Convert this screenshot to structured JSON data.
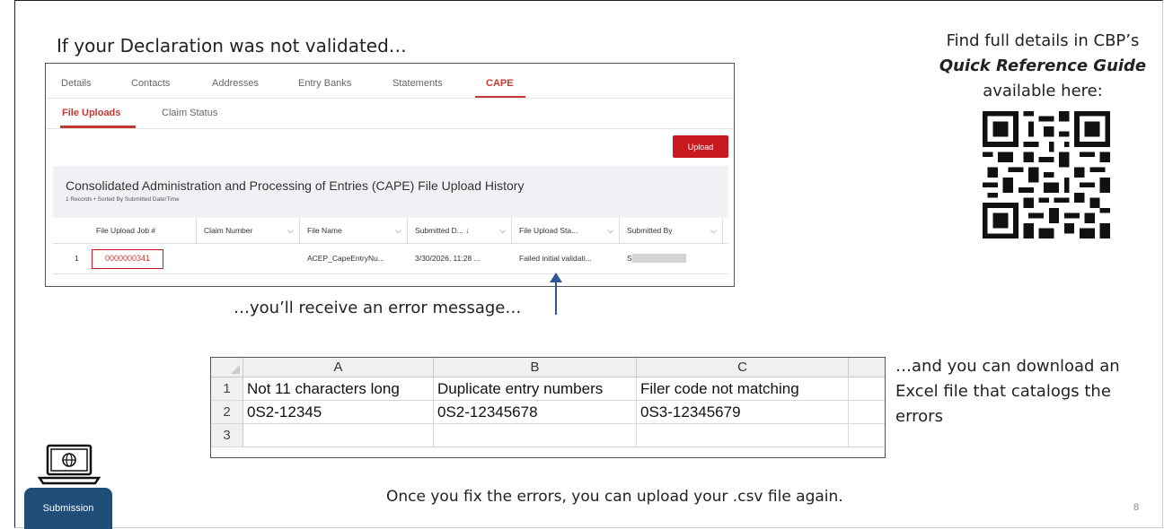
{
  "intro": "If your Declaration was not validated…",
  "guide": {
    "line1": "Find full details in CBP’s",
    "line2": "Quick Reference Guide",
    "line3": "available here:"
  },
  "app": {
    "tabs": [
      "Details",
      "Contacts",
      "Addresses",
      "Entry Banks",
      "Statements",
      "CAPE"
    ],
    "active_tab": "CAPE",
    "subtabs": [
      "File Uploads",
      "Claim Status"
    ],
    "upload_label": "Upload",
    "history_title": "Consolidated Administration and Processing of Entries (CAPE) File Upload History",
    "history_subtitle": "1 Records • Sorted By Submitted Date/Time",
    "columns": [
      "File Upload Job #",
      "Claim Number",
      "File Name",
      "Submitted D... ↓",
      "File Upload Sta...",
      "Submitted By"
    ],
    "row": {
      "index": "1",
      "job": "0000000341",
      "claim": "",
      "file_name": "ACEP_CapeEntryNu...",
      "submitted": "3/30/2026, 11:28 ...",
      "status": "Failed initial validati...",
      "submitted_by": "S"
    }
  },
  "error_text": "…you’ll receive an error message…",
  "excel": {
    "col_headers": [
      "A",
      "B",
      "C"
    ],
    "row_numbers": [
      "1",
      "2",
      "3"
    ],
    "rows": [
      [
        "Not 11 characters long",
        "Duplicate entry numbers",
        "Filer code not matching"
      ],
      [
        "0S2-12345",
        "0S2-12345678",
        "0S3-12345679"
      ],
      [
        "",
        "",
        ""
      ]
    ]
  },
  "download_text": "…and you can download an Excel file that catalogs the errors",
  "bottom_text": "Once you fix the errors, you can upload your .csv file again.",
  "page_number": "8",
  "submission_label": "Submission",
  "colors": {
    "accent_red": "#c8191e",
    "arrow_blue": "#2f5597",
    "submission_blue": "#1f4e79"
  }
}
